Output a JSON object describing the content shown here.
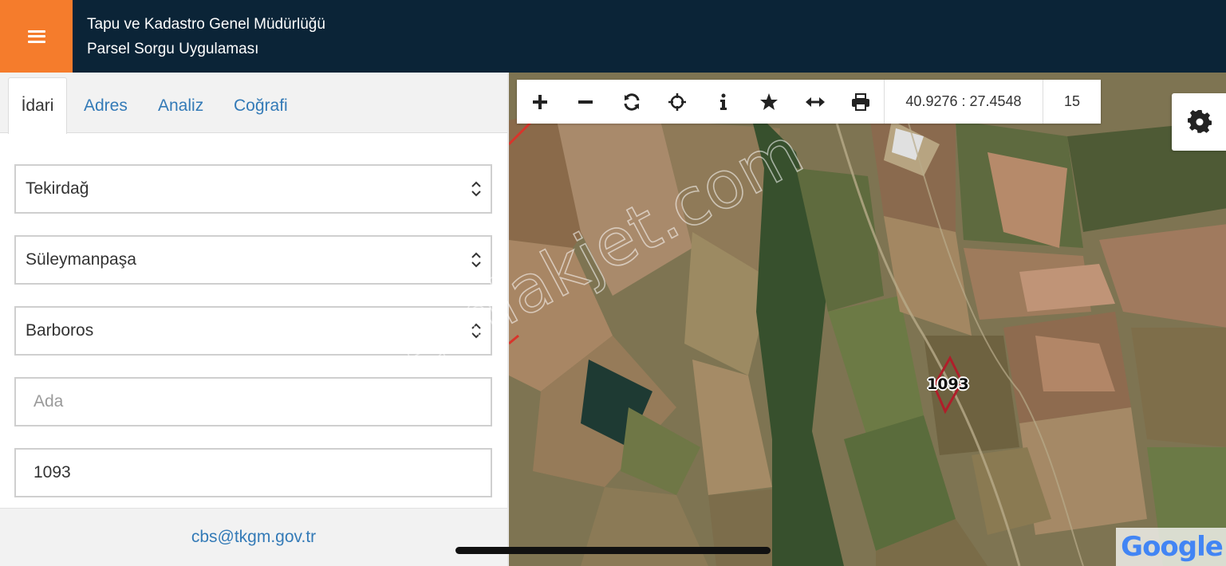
{
  "header": {
    "title_line1": "Tapu ve Kadastro Genel Müdürlüğü",
    "title_line2": "Parsel Sorgu Uygulaması",
    "menu_icon": "hamburger-icon",
    "colors": {
      "bar": "#0b2437",
      "menu": "#f57c2c"
    }
  },
  "tabs": [
    {
      "label": "İdari",
      "active": true
    },
    {
      "label": "Adres",
      "active": false
    },
    {
      "label": "Analiz",
      "active": false
    },
    {
      "label": "Coğrafi",
      "active": false
    }
  ],
  "form": {
    "il": {
      "value": "Tekirdağ"
    },
    "ilce": {
      "value": "Süleymanpaşa"
    },
    "mahalle": {
      "value": "Barboros"
    },
    "ada": {
      "value": "",
      "placeholder": "Ada"
    },
    "parsel": {
      "value": "1093"
    }
  },
  "footer": {
    "email": "cbs@tkgm.gov.tr"
  },
  "map": {
    "toolbar": {
      "icons": [
        "zoom-in-icon",
        "zoom-out-icon",
        "refresh-icon",
        "locate-icon",
        "info-icon",
        "favorite-icon",
        "measure-icon",
        "print-icon"
      ],
      "coordinates": "40.9276 : 27.4548",
      "zoom_level": "15"
    },
    "settings_icon": "gear-icon",
    "parcel_label": "1093",
    "watermark": "emlakjet.com",
    "attribution": "Google"
  }
}
